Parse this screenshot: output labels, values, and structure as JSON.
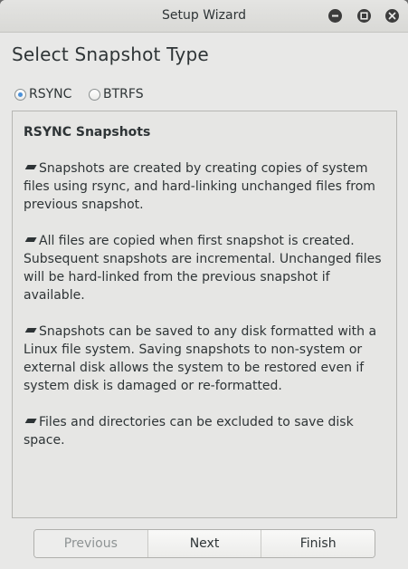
{
  "window": {
    "title": "Setup Wizard"
  },
  "page": {
    "heading": "Select Snapshot Type"
  },
  "snapshot_type": {
    "options": [
      {
        "label": "RSYNC",
        "selected": true
      },
      {
        "label": "BTRFS",
        "selected": false
      }
    ]
  },
  "info": {
    "title": "RSYNC Snapshots",
    "paragraphs": [
      "Snapshots are created by creating copies of system files using rsync, and hard-linking unchanged files from previous snapshot.",
      "All files are copied when first snapshot is created. Subsequent snapshots are incremental. Unchanged files will be hard-linked from the previous snapshot if available.",
      "Snapshots can be saved to any disk formatted with a Linux file system. Saving snapshots to non-system or external disk allows the system to be restored even if system disk is damaged or re-formatted.",
      "Files and directories can be excluded to save disk space."
    ]
  },
  "navigation": {
    "previous_label": "Previous",
    "previous_enabled": false,
    "next_label": "Next",
    "finish_label": "Finish"
  },
  "colors": {
    "radio_accent": "#4a90d9",
    "text": "#2e3436",
    "disabled_text": "#8e9394"
  }
}
